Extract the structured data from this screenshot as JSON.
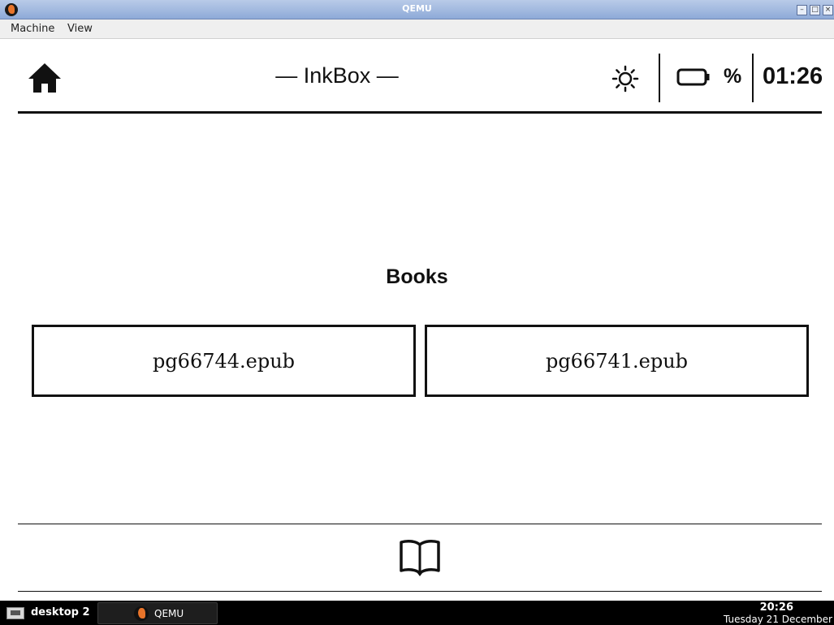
{
  "window": {
    "title": "QEMU"
  },
  "menubar": {
    "items": [
      "Machine",
      "View"
    ]
  },
  "inkbox": {
    "header": {
      "title": "— InkBox —",
      "battery_percent": "%",
      "clock": "01:26"
    },
    "section_title": "Books",
    "books": [
      "pg66744.epub",
      "pg66741.epub"
    ]
  },
  "taskbar": {
    "desktop_label": "desktop 2",
    "task_label": "QEMU",
    "time": "20:26",
    "date": "Tuesday 21 December"
  },
  "icons": {
    "home": "home-icon",
    "brightness": "brightness-icon",
    "battery": "battery-icon",
    "book": "book-open-icon"
  }
}
